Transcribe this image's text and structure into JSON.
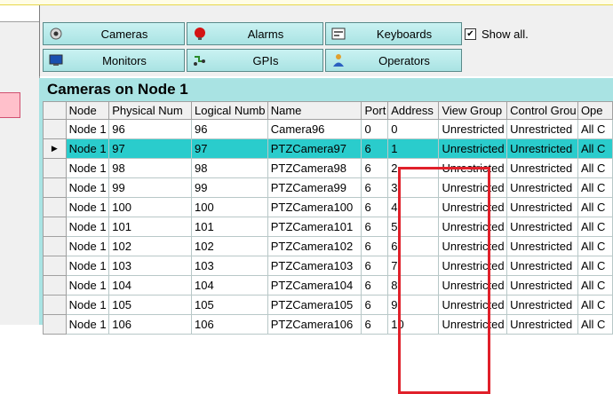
{
  "toolbar": {
    "buttons": [
      {
        "label": "Cameras",
        "icon": "camera-icon"
      },
      {
        "label": "Alarms",
        "icon": "alarm-icon"
      },
      {
        "label": "Keyboards",
        "icon": "keyboard-icon"
      },
      {
        "label": "Monitors",
        "icon": "monitor-icon"
      },
      {
        "label": "GPIs",
        "icon": "gpi-icon"
      },
      {
        "label": "Operators",
        "icon": "operators-icon"
      }
    ],
    "show_all": {
      "label": "Show all.",
      "checked": true
    }
  },
  "panel": {
    "title": "Cameras on Node 1",
    "columns": [
      "Node",
      "Physical Num",
      "Logical Numb",
      "Name",
      "Port",
      "Address",
      "View Group",
      "Control Grou",
      "Ope"
    ],
    "selected_row": 1,
    "rows": [
      [
        "Node 1",
        "96",
        "96",
        "Camera96",
        "0",
        "0",
        "Unrestricted",
        "Unrestricted",
        "All C"
      ],
      [
        "Node 1",
        "97",
        "97",
        "PTZCamera97",
        "6",
        "1",
        "Unrestricted",
        "Unrestricted",
        "All C"
      ],
      [
        "Node 1",
        "98",
        "98",
        "PTZCamera98",
        "6",
        "2",
        "Unrestricted",
        "Unrestricted",
        "All C"
      ],
      [
        "Node 1",
        "99",
        "99",
        "PTZCamera99",
        "6",
        "3",
        "Unrestricted",
        "Unrestricted",
        "All C"
      ],
      [
        "Node 1",
        "100",
        "100",
        "PTZCamera100",
        "6",
        "4",
        "Unrestricted",
        "Unrestricted",
        "All C"
      ],
      [
        "Node 1",
        "101",
        "101",
        "PTZCamera101",
        "6",
        "5",
        "Unrestricted",
        "Unrestricted",
        "All C"
      ],
      [
        "Node 1",
        "102",
        "102",
        "PTZCamera102",
        "6",
        "6",
        "Unrestricted",
        "Unrestricted",
        "All C"
      ],
      [
        "Node 1",
        "103",
        "103",
        "PTZCamera103",
        "6",
        "7",
        "Unrestricted",
        "Unrestricted",
        "All C"
      ],
      [
        "Node 1",
        "104",
        "104",
        "PTZCamera104",
        "6",
        "8",
        "Unrestricted",
        "Unrestricted",
        "All C"
      ],
      [
        "Node 1",
        "105",
        "105",
        "PTZCamera105",
        "6",
        "9",
        "Unrestricted",
        "Unrestricted",
        "All C"
      ],
      [
        "Node 1",
        "106",
        "106",
        "PTZCamera106",
        "6",
        "10",
        "Unrestricted",
        "Unrestricted",
        "All C"
      ]
    ]
  },
  "colors": {
    "accent": "#a9e3e3",
    "selected_row": "#2acccc",
    "highlight_box": "#e0202a"
  }
}
